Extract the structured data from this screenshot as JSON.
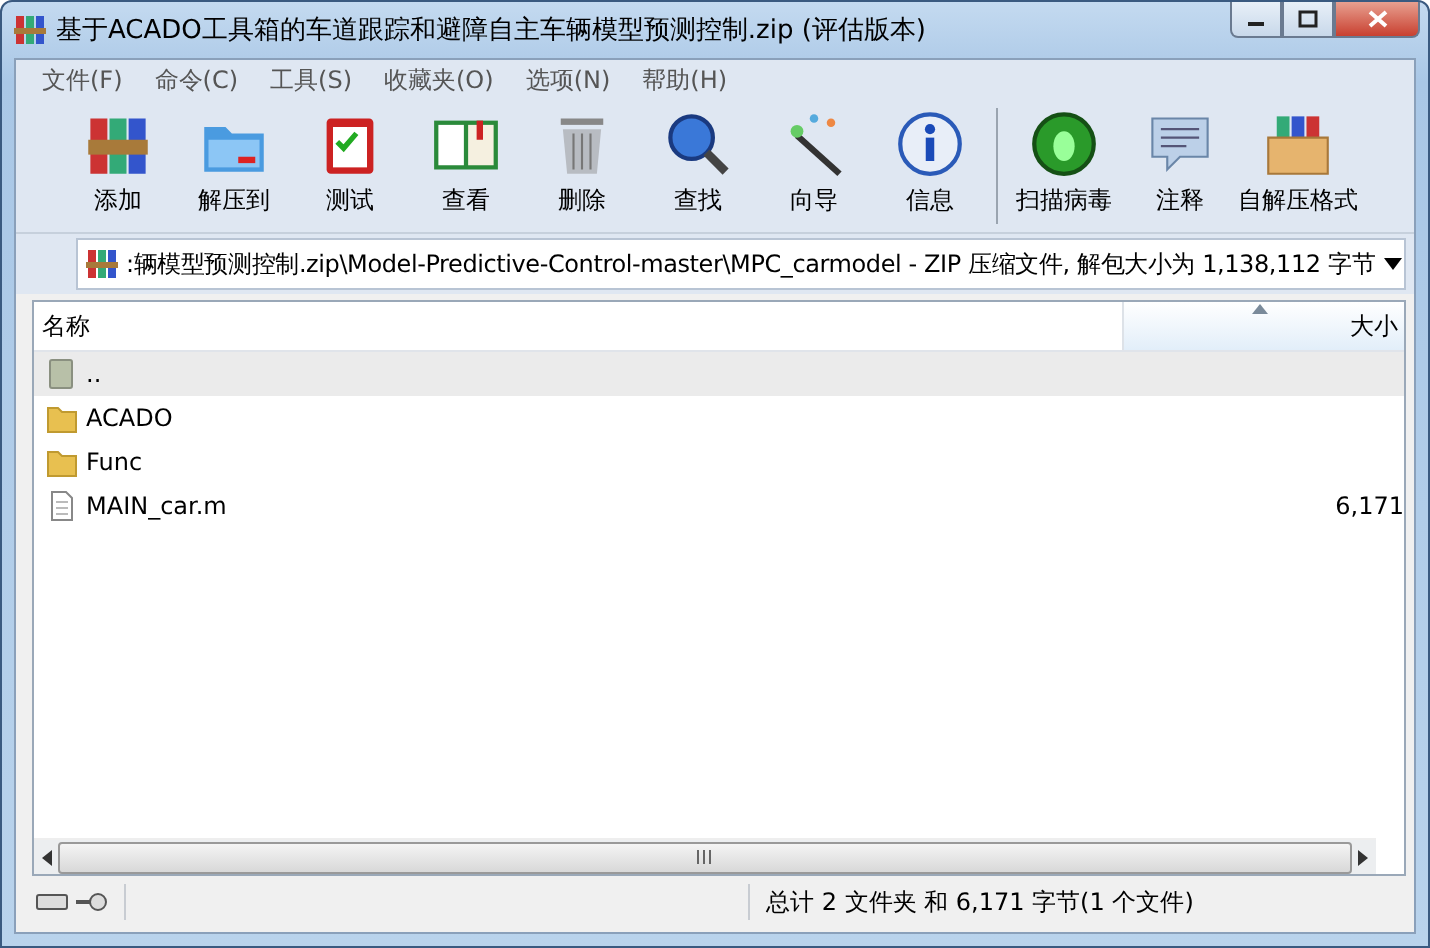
{
  "window": {
    "title": "基于ACADO工具箱的车道跟踪和避障自主车辆模型预测控制.zip (评估版本)"
  },
  "menu": [
    "文件(F)",
    "命令(C)",
    "工具(S)",
    "收藏夹(O)",
    "选项(N)",
    "帮助(H)"
  ],
  "toolbar": [
    {
      "label": "添加",
      "kind": "add",
      "separator_before": false
    },
    {
      "label": "解压到",
      "kind": "extract",
      "separator_before": false
    },
    {
      "label": "测试",
      "kind": "test",
      "separator_before": false
    },
    {
      "label": "查看",
      "kind": "view",
      "separator_before": false
    },
    {
      "label": "删除",
      "kind": "delete",
      "separator_before": false
    },
    {
      "label": "查找",
      "kind": "find",
      "separator_before": false
    },
    {
      "label": "向导",
      "kind": "wizard",
      "separator_before": false
    },
    {
      "label": "信息",
      "kind": "info",
      "separator_before": false
    },
    {
      "label": "扫描病毒",
      "kind": "scan",
      "separator_before": true
    },
    {
      "label": "注释",
      "kind": "comment",
      "separator_before": false
    },
    {
      "label": "自解压格式",
      "kind": "sfx",
      "separator_before": false
    }
  ],
  "address": {
    "path": ":辆模型预测控制.zip\\Model-Predictive-Control-master\\MPC_carmodel - ZIP 压缩文件, 解包大小为 1,138,112 字节"
  },
  "table": {
    "columns": [
      {
        "label": "名称",
        "sorted": false
      },
      {
        "label": "大小",
        "sorted": true
      }
    ],
    "rows": [
      {
        "name": "..",
        "kind": "up",
        "size": "",
        "selected": true
      },
      {
        "name": "ACADO",
        "kind": "folder",
        "size": "",
        "selected": false
      },
      {
        "name": "Func",
        "kind": "folder",
        "size": "",
        "selected": false
      },
      {
        "name": "MAIN_car.m",
        "kind": "file",
        "size": "6,171",
        "selected": false
      }
    ]
  },
  "status_bar": {
    "text": "总计 2 文件夹 和 6,171 字节(1 个文件)"
  }
}
